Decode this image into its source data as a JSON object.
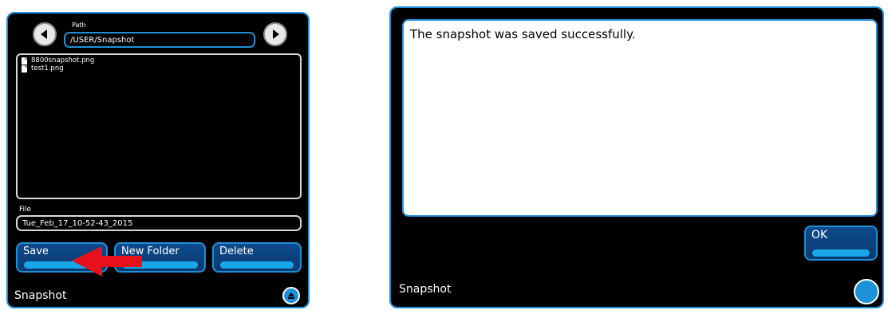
{
  "left_panel": {
    "path_label": "Path",
    "path_value": "/USER/Snapshot",
    "files": [
      {
        "name": "8800snapshot.png"
      },
      {
        "name": "test1.png"
      }
    ],
    "file_label": "File",
    "file_value": "Tue_Feb_17_10-52-43_2015",
    "buttons": {
      "save": "Save",
      "new_folder": "New Folder",
      "delete": "Delete"
    },
    "footer_title": "Snapshot"
  },
  "right_panel": {
    "message": "The snapshot was saved successfully.",
    "ok_label": "OK",
    "footer_title": "Snapshot"
  },
  "colors": {
    "accent": "#1e90d8",
    "background": "#000000",
    "annotation_arrow": "#e8101a"
  },
  "icons": [
    "chevron-left-icon",
    "chevron-right-icon",
    "document-icon",
    "scroll-up-icon",
    "red-arrow-annotation"
  ]
}
